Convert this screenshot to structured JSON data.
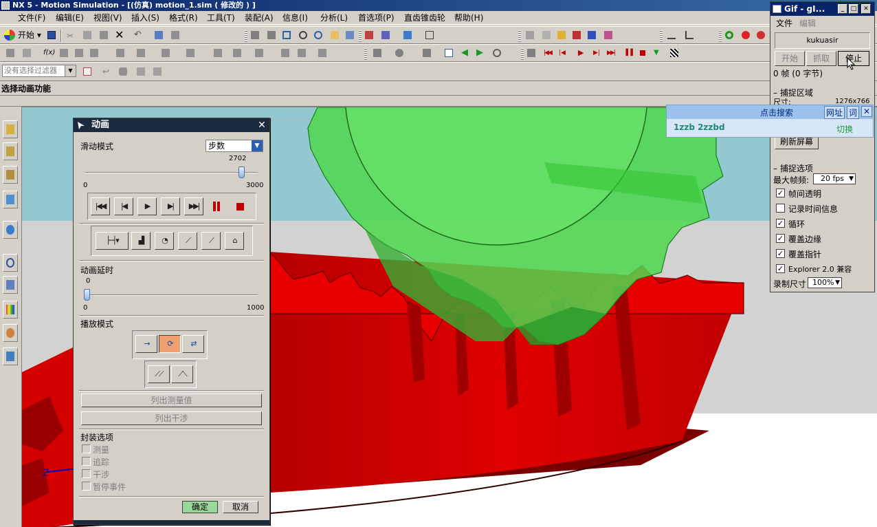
{
  "window": {
    "title": "NX 5 - Motion Simulation - [(仿真) motion_1.sim ( 修改的 ) ]"
  },
  "menu": [
    "文件(F)",
    "编辑(E)",
    "视图(V)",
    "插入(S)",
    "格式(R)",
    "工具(T)",
    "装配(A)",
    "信息(I)",
    "分析(L)",
    "首选项(P)",
    "直齿锥齿轮",
    "帮助(H)"
  ],
  "toolbar": {
    "start_label": "开始",
    "filter_placeholder": "没有选择过滤器"
  },
  "cue_line": "选择动画功能",
  "viewport": {
    "triad_label": "Z"
  },
  "animation_dialog": {
    "title": "动画",
    "slide_mode_label": "滑动模式",
    "slide_mode_value": "步数",
    "slider_value": "2702",
    "slider_min": "0",
    "slider_max": "3000",
    "slider_fraction": 0.9007,
    "delay_label": "动画延时",
    "delay_value": "0",
    "delay_min": "0",
    "delay_max": "1000",
    "delay_fraction": 0,
    "playback_mode_label": "播放模式",
    "list_measures_button": "列出测量值",
    "list_interference_button": "列出干涉",
    "packaging_options_label": "封装选项",
    "packaging_options": [
      "测量",
      "追踪",
      "干涉",
      "暂停事件"
    ],
    "ok_button": "确定",
    "cancel_button": "取消"
  },
  "gif_window": {
    "title": "Gif - gI...",
    "menu": [
      "文件",
      "编辑"
    ],
    "user": "kukuasir",
    "start_button": "开始",
    "capture_button": "抓取",
    "stop_button": "停止",
    "frames_text": "0 帧 (0 字节)",
    "capture_area_label": "捕捉区域",
    "size_label": "尺寸:",
    "size_value": "1276x766",
    "refresh_button": "刷新屏幕",
    "capture_options_label": "捕捉选项",
    "max_fps_label": "最大帧频:",
    "max_fps_value": "20 fps",
    "options": [
      {
        "label": "帧间透明",
        "checked": true
      },
      {
        "label": "记录时间信息",
        "checked": false
      },
      {
        "label": "循环",
        "checked": true
      },
      {
        "label": "覆盖边缘",
        "checked": true
      },
      {
        "label": "覆盖指针",
        "checked": true
      },
      {
        "label": "Explorer 2.0 兼容",
        "checked": true
      }
    ],
    "record_size_label": "录制尺寸",
    "record_size_value": "100%"
  },
  "search_bar": {
    "title": "点击搜索",
    "url_button": "网址",
    "word_button": "词",
    "query": "1zzb 2zzbd",
    "switch_link": "切换"
  },
  "colors": {
    "viewport_bg": "#ffffff",
    "horizon": "#92c9d1",
    "ground": "#d4d4d4",
    "gear_red": "#e60000",
    "gear_dark": "#8a0000",
    "gear_green": "#4ed84e",
    "title_dark": "#1c2a3e"
  }
}
